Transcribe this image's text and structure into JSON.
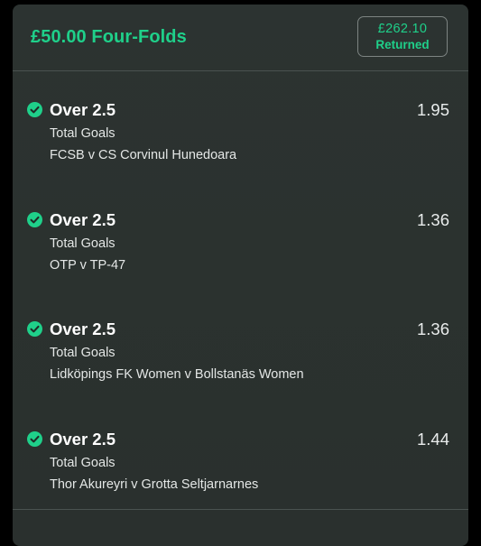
{
  "bet": {
    "title": "£50.00 Four-Folds",
    "returned_amount": "£262.10",
    "returned_label": "Returned"
  },
  "colors": {
    "accent": "#1fd08a",
    "card_bg": "#2c3331",
    "text": "#ffffff"
  },
  "selections": [
    {
      "status_icon": "check-circle-icon",
      "name": "Over 2.5",
      "market": "Total Goals",
      "event": "FCSB v CS Corvinul Hunedoara",
      "odds": "1.95"
    },
    {
      "status_icon": "check-circle-icon",
      "name": "Over 2.5",
      "market": "Total Goals",
      "event": "OTP v TP-47",
      "odds": "1.36"
    },
    {
      "status_icon": "check-circle-icon",
      "name": "Over 2.5",
      "market": "Total Goals",
      "event": "Lidköpings FK Women v Bollstanäs Women",
      "odds": "1.36"
    },
    {
      "status_icon": "check-circle-icon",
      "name": "Over 2.5",
      "market": "Total Goals",
      "event": "Thor Akureyri v Grotta Seltjarnarnes",
      "odds": "1.44"
    }
  ]
}
